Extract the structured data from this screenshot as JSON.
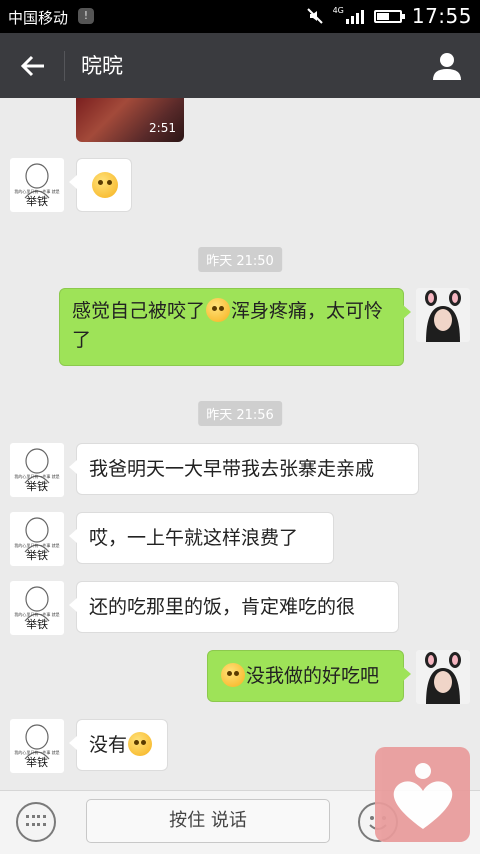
{
  "status_bar": {
    "carrier": "中国移动",
    "notification_badge": "!",
    "network": "4G",
    "time": "17:55",
    "battery_level": 0.55
  },
  "title_bar": {
    "title": "晥晥"
  },
  "video": {
    "duration": "2:51"
  },
  "timestamps": [
    "昨天 21:50",
    "昨天 21:56"
  ],
  "avatar_left_caption": "举铁",
  "avatar_left_small_text": "我的心里只有一件事 就是",
  "messages": [
    {
      "side": "left",
      "parts": [],
      "emoji_only": true
    },
    {
      "side": "right",
      "text_a": "感觉自己被咬了",
      "text_b": "浑身疼痛，太可怜了"
    },
    {
      "side": "left",
      "text": "我爸明天一大早带我去张寨走亲戚"
    },
    {
      "side": "left",
      "text": "哎，一上午就这样浪费了"
    },
    {
      "side": "left",
      "text": "还的吃那里的饭，肯定难吃的很"
    },
    {
      "side": "right",
      "text": "没我做的好吃吧"
    },
    {
      "side": "left",
      "text": "没有"
    }
  ],
  "input_bar": {
    "hold_to_talk": "按住 说话"
  },
  "colors": {
    "right_bubble": "#9ee358",
    "title_bar": "#3a3b3f",
    "floating_button": "#e99b9b"
  }
}
